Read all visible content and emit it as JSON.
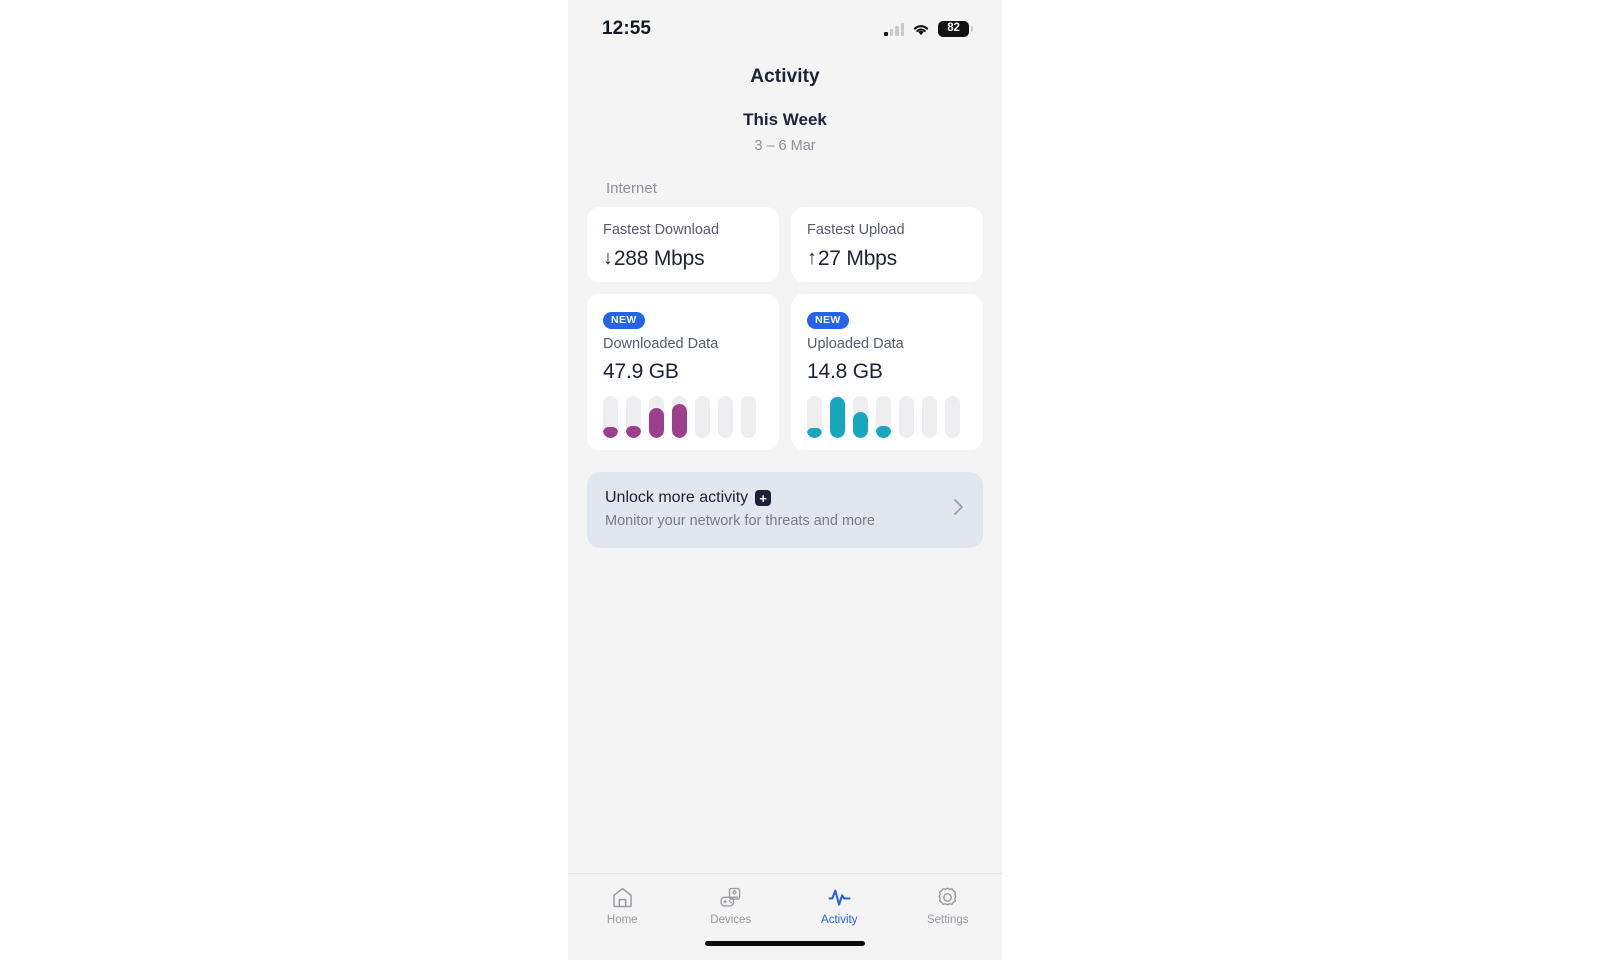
{
  "status_bar": {
    "time": "12:55",
    "signal_icon": "cellular-signal-icon",
    "signal_bars_filled": 1,
    "signal_bars_total": 4,
    "wifi_icon": "wifi-icon",
    "battery_icon": "battery-icon",
    "battery_level": "82"
  },
  "header": {
    "app_title": "Activity",
    "period_title": "This Week",
    "period_range": "3 – 6 Mar"
  },
  "section": {
    "label": "Internet"
  },
  "speed_cards": [
    {
      "label": "Fastest Download",
      "arrow": "↓",
      "arrow_icon": "arrow-down-icon",
      "value": "288 Mbps"
    },
    {
      "label": "Fastest Upload",
      "arrow": "↑",
      "arrow_icon": "arrow-up-icon",
      "value": "27 Mbps"
    }
  ],
  "data_cards": [
    {
      "badge": "NEW",
      "label": "Downloaded Data",
      "value": "47.9 GB",
      "color": "#9c3f8c",
      "track_color": "#eeeef1"
    },
    {
      "badge": "NEW",
      "label": "Uploaded Data",
      "value": "14.8 GB",
      "color": "#17a8c0",
      "track_color": "#eeeef1"
    }
  ],
  "promo": {
    "title": "Unlock more activity",
    "plus_icon": "plus-badge-icon",
    "subtitle": "Monitor your network for threats and more",
    "chevron_icon": "chevron-right-icon"
  },
  "tabs": [
    {
      "label": "Home",
      "icon": "home-icon",
      "active": false
    },
    {
      "label": "Devices",
      "icon": "devices-icon",
      "active": false
    },
    {
      "label": "Activity",
      "icon": "activity-pulse-icon",
      "active": true
    },
    {
      "label": "Settings",
      "icon": "gear-icon",
      "active": false
    }
  ],
  "colors": {
    "accent": "#2563eb",
    "download": "#9c3f8c",
    "upload": "#17a8c0",
    "page_bg": "#f4f4f5",
    "card_bg": "#ffffff",
    "promo_bg": "#e2e6ef",
    "text_primary": "#1c2237",
    "text_muted": "#8d909b"
  },
  "chart_data": [
    {
      "type": "bar",
      "title": "Downloaded Data",
      "total": "47.9 GB",
      "categories": [
        "1",
        "2",
        "3",
        "4",
        "5",
        "6",
        "7"
      ],
      "values": [
        28,
        30,
        72,
        83,
        0,
        0,
        0
      ],
      "unit": "%",
      "ylim": [
        0,
        100
      ],
      "color": "#9c3f8c",
      "track_color": "#eeeef1",
      "grid": false,
      "legend": "none",
      "xlabel": "",
      "ylabel": ""
    },
    {
      "type": "bar",
      "title": "Uploaded Data",
      "total": "14.8 GB",
      "categories": [
        "1",
        "2",
        "3",
        "4",
        "5",
        "6",
        "7"
      ],
      "values": [
        26,
        98,
        62,
        30,
        0,
        0,
        0
      ],
      "unit": "%",
      "ylim": [
        0,
        100
      ],
      "color": "#17a8c0",
      "track_color": "#eeeef1",
      "grid": false,
      "legend": "none",
      "xlabel": "",
      "ylabel": ""
    }
  ]
}
